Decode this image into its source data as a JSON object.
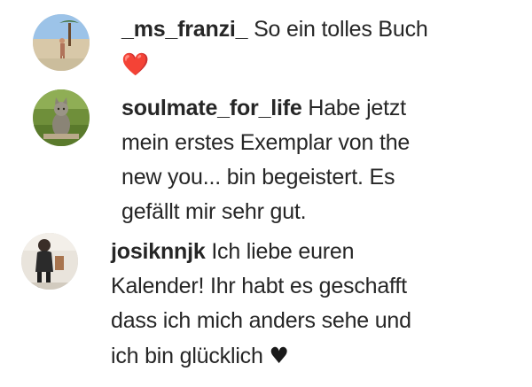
{
  "comments": [
    {
      "username": "_ms_franzi_",
      "lines": [
        "So ein tolles Buch"
      ],
      "emoji": "❤️",
      "emoji_color": "#e0202a",
      "avatar_icon": "beach-photo-avatar"
    },
    {
      "username": "soulmate_for_life",
      "lines": [
        "Habe jetzt",
        "mein erstes Exemplar von the",
        "new you... bin begeistert. Es",
        "gefällt mir sehr gut."
      ],
      "avatar_icon": "cat-photo-avatar"
    },
    {
      "username": "josiknnjk",
      "lines": [
        "Ich liebe euren",
        "Kalender! Ihr habt es geschafft",
        "dass ich mich anders sehe und",
        "ich bin glücklich"
      ],
      "emoji": "♥",
      "emoji_color": "#1a1a1a",
      "avatar_icon": "person-photo-avatar"
    }
  ]
}
